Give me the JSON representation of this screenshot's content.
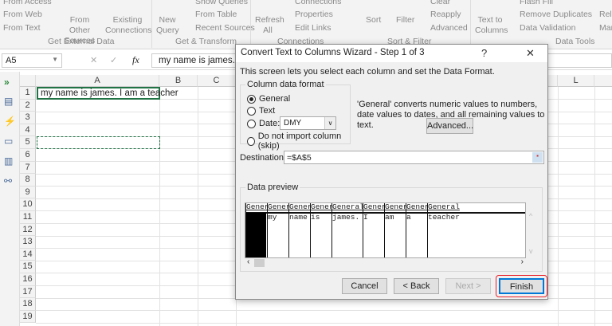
{
  "ribbon": {
    "from_access": "From Access",
    "from_web": "From Web",
    "from_text": "From Text",
    "from_other_sources": "From Other Sources",
    "existing_connections": "Existing Connections",
    "new_query": "New Query",
    "show_queries": "Show Queries",
    "from_table": "From Table",
    "recent_sources": "Recent Sources",
    "refresh_all": "Refresh All",
    "connections": "Connections",
    "properties": "Properties",
    "edit_links": "Edit Links",
    "sort": "Sort",
    "filter": "Filter",
    "clear": "Clear",
    "reapply": "Reapply",
    "advanced": "Advanced",
    "text_to_columns": "Text to Columns",
    "flash_fill": "Flash Fill",
    "remove_duplicates": "Remove Duplicates",
    "data_validation": "Data Validation",
    "relationships": "Rela",
    "manage": "Man",
    "groups": [
      "Get External Data",
      "Get & Transform",
      "Connections",
      "Sort & Filter",
      "Data Tools"
    ]
  },
  "formula_bar": {
    "name_box": "A5",
    "fx": "fx",
    "cancel": "✕",
    "enter": "✓",
    "content": "my name is james. I"
  },
  "sheet": {
    "columns": [
      "A",
      "B",
      "C",
      "L"
    ],
    "rows": [
      "1",
      "2",
      "3",
      "4",
      "5",
      "6",
      "7",
      "8",
      "9",
      "10",
      "11",
      "12",
      "13",
      "14",
      "15",
      "16",
      "17",
      "18",
      "19"
    ],
    "a1": "my name is james. I am a teacher"
  },
  "dialog": {
    "title": "Convert Text to Columns Wizard - Step 1 of 3",
    "help": "?",
    "close": "✕",
    "intro": "This screen lets you select each column and set the Data Format.",
    "group_label": "Column data format",
    "options": [
      "General",
      "Text",
      "Date:",
      "Do not import column (skip)"
    ],
    "selected": "General",
    "date_format": "DMY",
    "description": "'General' converts numeric values to numbers, date values to dates, and all remaining values to text.",
    "advanced": "Advanced...",
    "destination_label": "Destination:",
    "destination_value": "=$A$5",
    "preview_label": "Data preview",
    "preview_headers": [
      "Gener",
      "Gener",
      "Gener",
      "Gener",
      "General",
      "Gener",
      "Gener",
      "Gener",
      "General"
    ],
    "preview_values": [
      "",
      "my",
      "name",
      "is",
      "james.",
      "I",
      "am",
      "a",
      "teacher"
    ],
    "buttons": {
      "cancel": "Cancel",
      "back": "< Back",
      "next": "Next >",
      "finish": "Finish"
    },
    "highlight_color": "#e8202a"
  }
}
